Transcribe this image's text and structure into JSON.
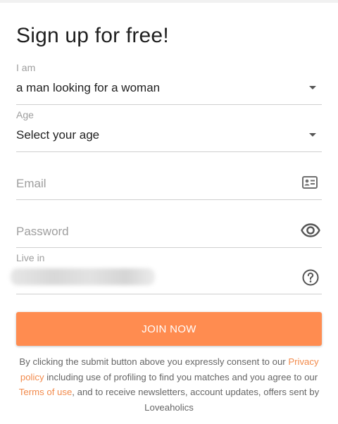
{
  "form": {
    "title": "Sign up for free!",
    "i_am": {
      "label": "I am",
      "value": "a man looking for a woman"
    },
    "age": {
      "label": "Age",
      "value": "Select your age"
    },
    "email": {
      "placeholder": "Email",
      "icon": "contact-card-icon"
    },
    "password": {
      "placeholder": "Password",
      "icon": "eye-icon"
    },
    "live_in": {
      "label": "Live in",
      "icon": "help-circle-icon"
    },
    "submit_label": "JOIN NOW"
  },
  "consent": {
    "text_1": "By clicking the submit button above you expressly consent to our",
    "privacy_link": "Privacy policy",
    "text_2": "including use of profiling to find you matches and you agree to our",
    "terms_link": "Terms of use",
    "text_3": ", and to receive newsletters, account updates, offers sent by Loveaholics"
  },
  "colors": {
    "accent": "#ff8c50",
    "link": "#f28a4b",
    "label_gray": "#9e9e9e",
    "divider": "#cfcfcf"
  }
}
